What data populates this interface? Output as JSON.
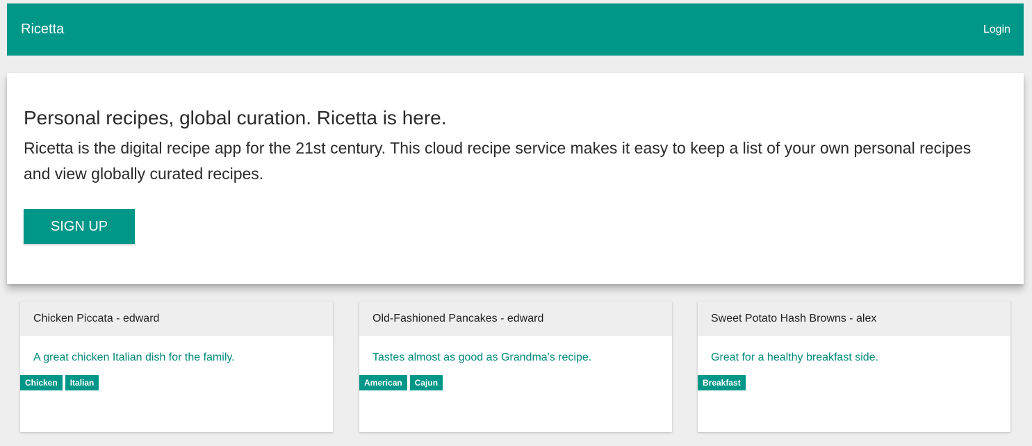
{
  "navbar": {
    "brand": "Ricetta",
    "login_label": "Login"
  },
  "hero": {
    "headline": "Personal recipes, global curation. Ricetta is here.",
    "lead": "Ricetta is the digital recipe app for the 21st century. This cloud recipe service makes it easy to keep a list of your own personal recipes and view globally curated recipes.",
    "signup_label": "SIGN UP"
  },
  "recipes": [
    {
      "title": "Chicken Piccata - edward",
      "description": "A great chicken Italian dish for the family.",
      "tags": [
        "Chicken",
        "Italian"
      ]
    },
    {
      "title": "Old-Fashioned Pancakes - edward",
      "description": "Tastes almost as good as Grandma's recipe.",
      "tags": [
        "American",
        "Cajun"
      ]
    },
    {
      "title": "Sweet Potato Hash Browns - alex",
      "description": "Great for a healthy breakfast side.",
      "tags": [
        "Breakfast"
      ]
    }
  ],
  "colors": {
    "primary": "#009688",
    "accent_text": "#00897b",
    "background": "#eeeeee",
    "card_header": "#eeeeee"
  }
}
